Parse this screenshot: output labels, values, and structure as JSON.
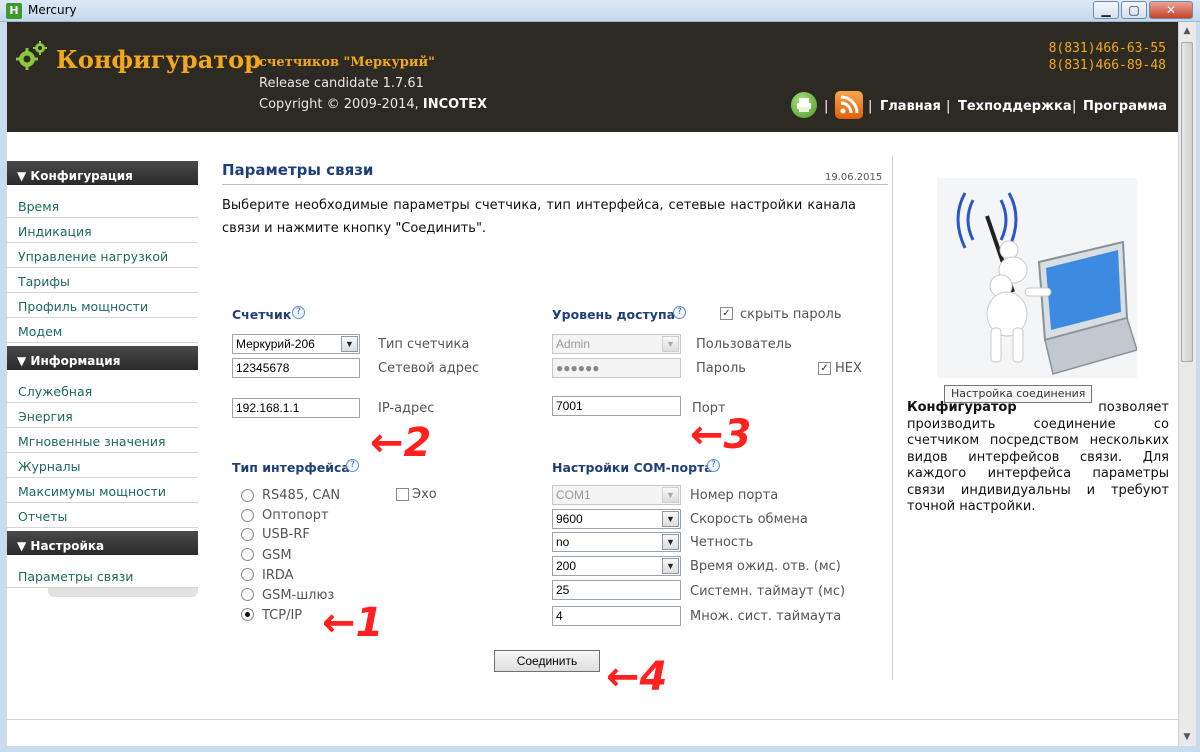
{
  "window": {
    "title": "Mercury",
    "app_icon": "H",
    "buttons": {
      "minimize": "▁",
      "maximize": "▢",
      "close": "✕"
    }
  },
  "header": {
    "brand": "Конфигуратор",
    "brand_sub": "счетчиков \"Меркурий\"",
    "release": "Release candidate 1.7.61",
    "copyright_prefix": "Copyright © 2009-2014, ",
    "copyright_company": "INCOTEX",
    "phones": [
      "8(831)466-63-55",
      "8(831)466-89-48"
    ],
    "nav_sep": "|",
    "nav": [
      "Главная",
      "Техподдержка",
      "Программа"
    ],
    "icons": {
      "print": "print-icon",
      "rss": "rss-icon",
      "logo": "gear-icon"
    }
  },
  "sidebar": {
    "sections": [
      {
        "title": "▼ Конфигурация",
        "items": [
          "Время",
          "Индикация",
          "Управление нагрузкой",
          "Тарифы",
          "Профиль мощности",
          "Модем"
        ]
      },
      {
        "title": "▼ Информация",
        "items": [
          "Служебная",
          "Энергия",
          "Мгновенные значения",
          "Журналы",
          "Максимумы мощности",
          "Отчеты"
        ]
      },
      {
        "title": "▼ Настройка",
        "items": [
          "Параметры связи"
        ]
      }
    ]
  },
  "main": {
    "title": "Параметры связи",
    "date": "19.06.2015",
    "intro": "Выберите необходимые параметры счетчика, тип интерфейса, сетевые настройки канала связи и нажмите кнопку \"Соединить\".",
    "help_glyph": "?",
    "meter": {
      "heading": "Счетчик",
      "type_value": "Меркурий-206",
      "type_label": "Тип счетчика",
      "address_value": "12345678",
      "address_label": "Сетевой адрес",
      "ip_value": "192.168.1.1",
      "ip_label": "IP-адрес"
    },
    "access": {
      "heading": "Уровень доступа",
      "hide_password_label": "скрыть пароль",
      "hide_password_checked": true,
      "user_value": "Admin",
      "user_label": "Пользователь",
      "password_value": "●●●●●●",
      "password_label": "Пароль",
      "hex_label": "HEX",
      "hex_checked": true,
      "port_value": "7001",
      "port_label": "Порт"
    },
    "interface": {
      "heading": "Тип интерфейса",
      "options": [
        "RS485, CAN",
        "Оптопорт",
        "USB-RF",
        "GSM",
        "IRDA",
        "GSM-шлюз",
        "TCP/IP"
      ],
      "selected": "TCP/IP",
      "echo_label": "Эхо",
      "echo_checked": false
    },
    "com": {
      "heading": "Настройки COM-порта",
      "port_value": "COM1",
      "port_label": "Номер порта",
      "speed_value": "9600",
      "speed_label": "Скорость обмена",
      "parity_value": "no",
      "parity_label": "Четность",
      "wait_value": "200",
      "wait_label": "Время ожид. отв. (мс)",
      "timeout_value": "25",
      "timeout_label": "Системн. таймаут (мс)",
      "mult_value": "4",
      "mult_label": "Множ. сист. таймаута"
    },
    "connect_label": "Соединить",
    "annotations": {
      "a1": "←1",
      "a2": "←2",
      "a3": "←3",
      "a4": "←4"
    }
  },
  "right_panel": {
    "tooltip": "Настройка соединения",
    "desc_bold": "Конфигуратор",
    "desc_rest": " позволяет производить соединение со счетчиком посредством нескольких видов интерфейсов связи. Для каждого интерфейса параметры связи индивидуальны и требуют точной настройки."
  }
}
